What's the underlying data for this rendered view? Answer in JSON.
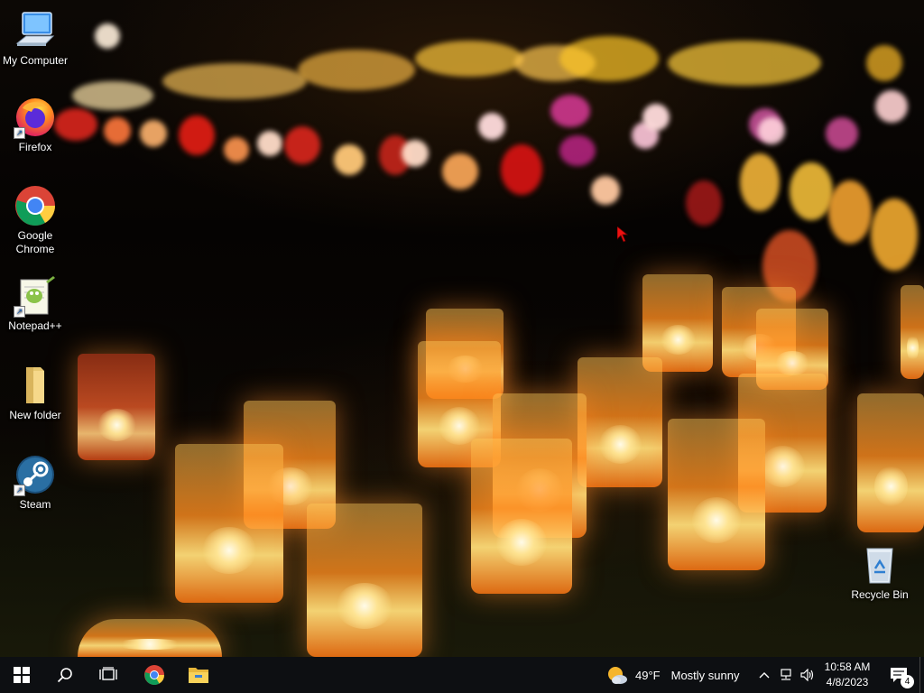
{
  "desktop": {
    "icons": [
      {
        "label": "My Computer",
        "icon": "computer-icon"
      },
      {
        "label": "Firefox",
        "icon": "firefox-icon"
      },
      {
        "label": "Google Chrome",
        "icon": "chrome-icon"
      },
      {
        "label": "Notepad++",
        "icon": "notepadpp-icon"
      },
      {
        "label": "New folder",
        "icon": "folder-icon"
      },
      {
        "label": "Steam",
        "icon": "steam-icon"
      },
      {
        "label": "Recycle Bin",
        "icon": "recycle-bin-icon"
      }
    ]
  },
  "taskbar": {
    "start_icon": "windows-start-icon",
    "search_icon": "search-icon",
    "task_view_icon": "task-view-icon",
    "pinned": [
      {
        "name": "Google Chrome",
        "icon": "chrome-icon"
      },
      {
        "name": "File Explorer",
        "icon": "file-explorer-icon"
      }
    ],
    "weather": {
      "temperature": "49°F",
      "condition": "Mostly sunny",
      "icon": "partly-sunny-icon"
    },
    "tray_icons": [
      "chevron-up-icon",
      "network-icon",
      "volume-icon"
    ],
    "clock": {
      "time": "10:58 AM",
      "date": "4/8/2023"
    },
    "notifications": {
      "count": "4",
      "icon": "action-center-icon"
    }
  },
  "colors": {
    "taskbar_bg": "#0d0f12",
    "accent": "#8fb3e6"
  }
}
